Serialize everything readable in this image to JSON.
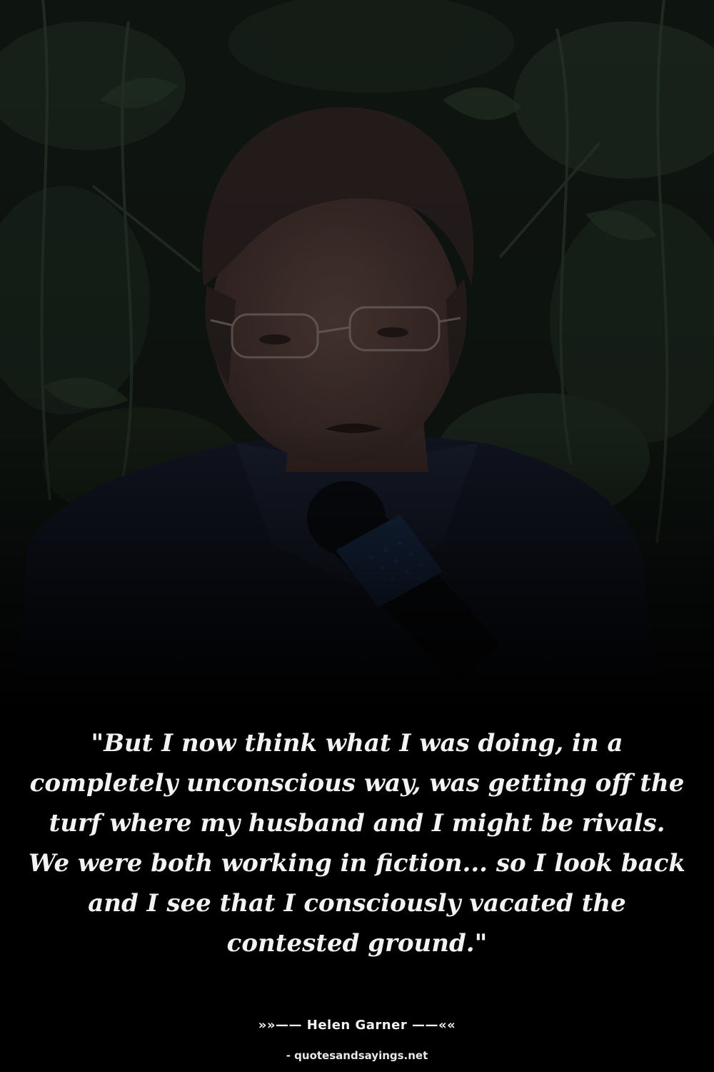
{
  "photo": {
    "subject": "woman-speaking-into-microphone",
    "background": "foliage",
    "colors": {
      "foliage_dark": "#141b16",
      "foliage_mid": "#243327",
      "skin": "#4a3430",
      "hair": "#2b2220",
      "jacket": "#161a2a",
      "microphone": "#0d0f14",
      "mic_band": "#1d3556"
    }
  },
  "quote": {
    "text": "\"But I now think what I was doing, in a completely unconscious way, was getting off the turf where my husband and I might be rivals. We were both working in fiction... so I look back and I see that I consciously vacated the contested ground.\""
  },
  "attribution": {
    "text": "»»—— Helen Garner ——««"
  },
  "site": {
    "text": "- quotesandsayings.net"
  }
}
